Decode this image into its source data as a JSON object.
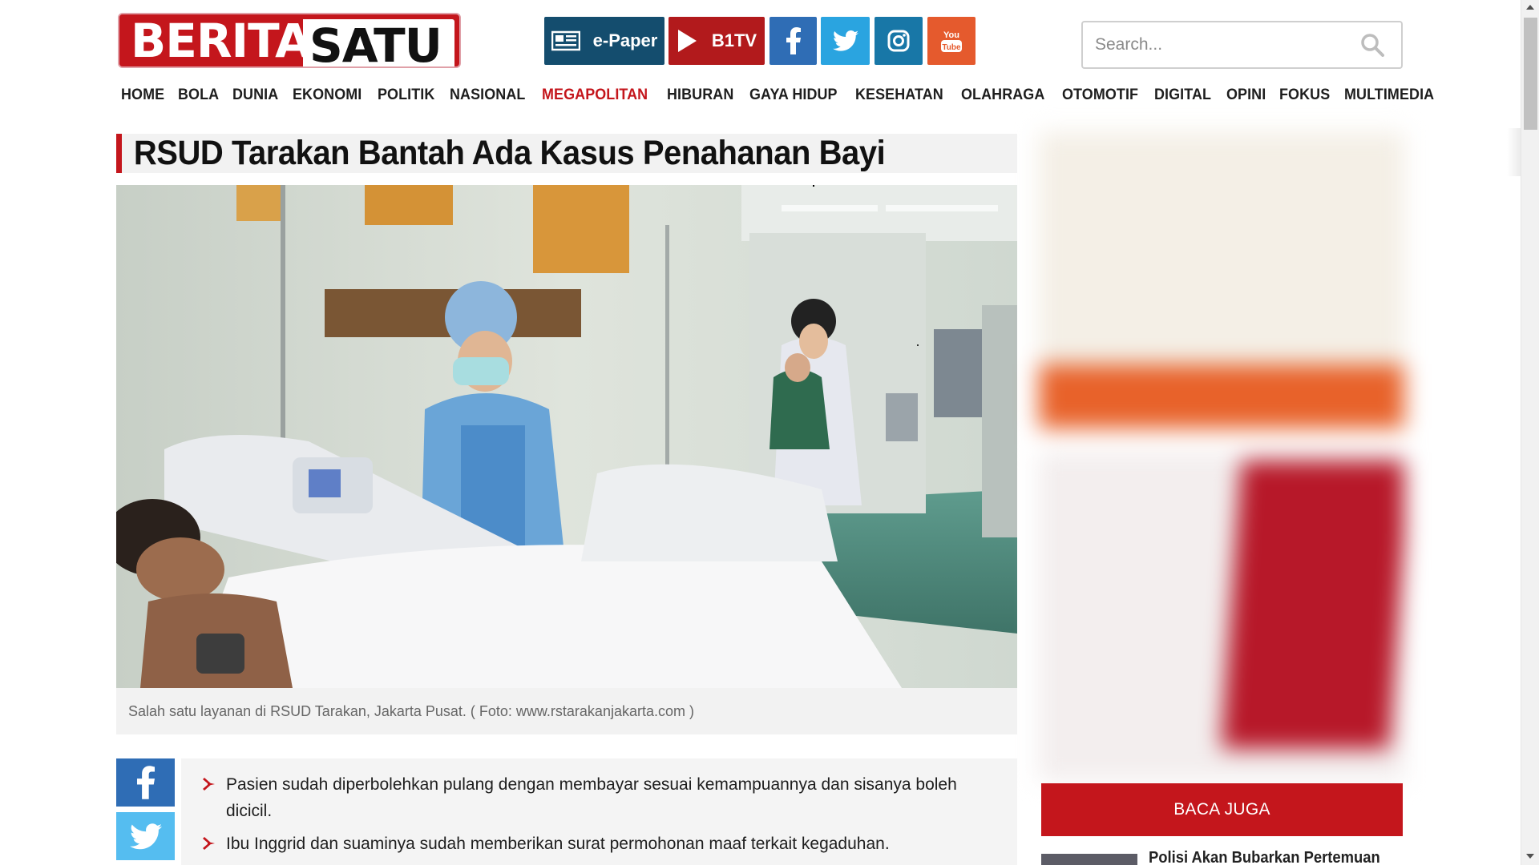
{
  "header": {
    "logo_left": "BERITA",
    "logo_right": "SATU",
    "epaper_label": "e-Paper",
    "b1tv_label": "B1TV",
    "search_placeholder": "Search...",
    "social": [
      "facebook-icon",
      "twitter-icon",
      "instagram-icon",
      "youtube-icon"
    ],
    "youtube_text": "You Tube"
  },
  "nav": {
    "items": [
      "HOME",
      "BOLA",
      "DUNIA",
      "EKONOMI",
      "POLITIK",
      "NASIONAL",
      "MEGAPOLITAN",
      "HIBURAN",
      "GAYA HIDUP",
      "KESEHATAN",
      "OLAHRAGA",
      "OTOMOTIF",
      "DIGITAL",
      "OPINI",
      "FOKUS",
      "MULTIMEDIA"
    ],
    "active": "MEGAPOLITAN"
  },
  "article": {
    "title": "RSUD Tarakan Bantah Ada Kasus Penahanan Bayi",
    "caption": "Salah satu layanan di RSUD Tarakan, Jakarta Pusat. ( Foto: www.rstarakanjakarta.com )",
    "summary": [
      "Pasien sudah diperbolehkan pulang dengan membayar sesuai kemampuannya dan sisanya boleh dicicil.",
      "Ibu Inggrid dan suaminya sudah memberikan surat permohonan maaf terkait kegaduhan."
    ]
  },
  "sidebar": {
    "baca_juga": "BACA JUGA",
    "related_title": "Polisi Akan Bubarkan Pertemuan"
  },
  "colors": {
    "brand_red": "#c4161c",
    "epaper_blue": "#144d6e",
    "facebook": "#2f6db5",
    "twitter": "#2aa4e0",
    "instagram": "#1877a7",
    "youtube": "#e55a2d"
  }
}
